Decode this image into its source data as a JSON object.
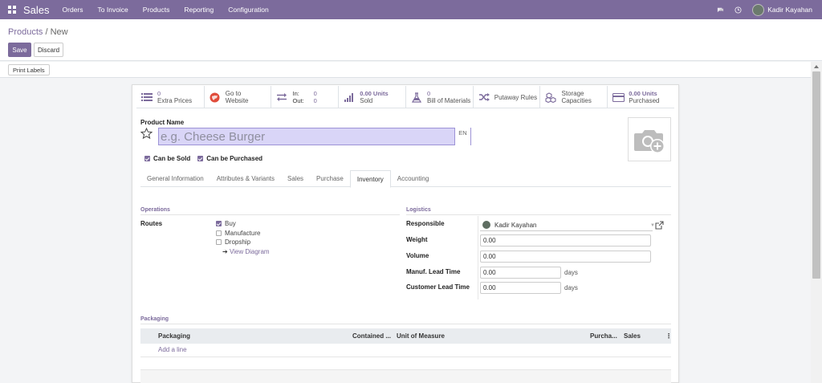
{
  "navbar": {
    "app_name": "Sales",
    "menu": [
      "Orders",
      "To Invoice",
      "Products",
      "Reporting",
      "Configuration"
    ],
    "username": "Kadir Kayahan",
    "color": "#7c6b9c"
  },
  "breadcrumb": {
    "parent": "Products",
    "separator": " / ",
    "current": "New"
  },
  "actions": {
    "save": "Save",
    "discard": "Discard",
    "print_labels": "Print Labels"
  },
  "smart_buttons": [
    {
      "icon": "list-icon",
      "value": "0",
      "label": "Extra Prices"
    },
    {
      "icon": "globe-icon",
      "value": "Go to",
      "label": "Website"
    },
    {
      "icon": "exchange-icon",
      "in_label": "In:",
      "in_value": "0",
      "out_label": "Out:",
      "out_value": "0"
    },
    {
      "icon": "bar-chart-icon",
      "value": "0.00 Units",
      "label": "Sold"
    },
    {
      "icon": "flask-icon",
      "value": "0",
      "label": "Bill of Materials"
    },
    {
      "icon": "random-icon",
      "label": "Putaway Rules"
    },
    {
      "icon": "cubes-icon",
      "value": "Storage",
      "label": "Capacities"
    },
    {
      "icon": "credit-card-icon",
      "value": "0.00 Units",
      "label": "Purchased"
    }
  ],
  "product": {
    "name_label": "Product Name",
    "name_placeholder": "e.g. Cheese Burger",
    "lang": "EN",
    "can_be_sold": "Can be Sold",
    "can_be_purchased": "Can be Purchased"
  },
  "tabs": [
    "General Information",
    "Attributes & Variants",
    "Sales",
    "Purchase",
    "Inventory",
    "Accounting"
  ],
  "active_tab": "Inventory",
  "operations": {
    "title": "Operations",
    "routes_label": "Routes",
    "routes": [
      {
        "label": "Buy",
        "checked": true
      },
      {
        "label": "Manufacture",
        "checked": false
      },
      {
        "label": "Dropship",
        "checked": false
      }
    ],
    "view_diagram": "View Diagram"
  },
  "logistics": {
    "title": "Logistics",
    "responsible_label": "Responsible",
    "responsible_value": "Kadir Kayahan",
    "weight_label": "Weight",
    "weight_value": "0.00",
    "volume_label": "Volume",
    "volume_value": "0.00",
    "manuf_lead_label": "Manuf. Lead Time",
    "manuf_lead_value": "0.00",
    "customer_lead_label": "Customer Lead Time",
    "customer_lead_value": "0.00",
    "days": "days"
  },
  "packaging": {
    "title": "Packaging",
    "columns": [
      "Packaging",
      "Contained ...",
      "Unit of Measure",
      "Purcha...",
      "Sales"
    ],
    "add_line": "Add a line"
  }
}
